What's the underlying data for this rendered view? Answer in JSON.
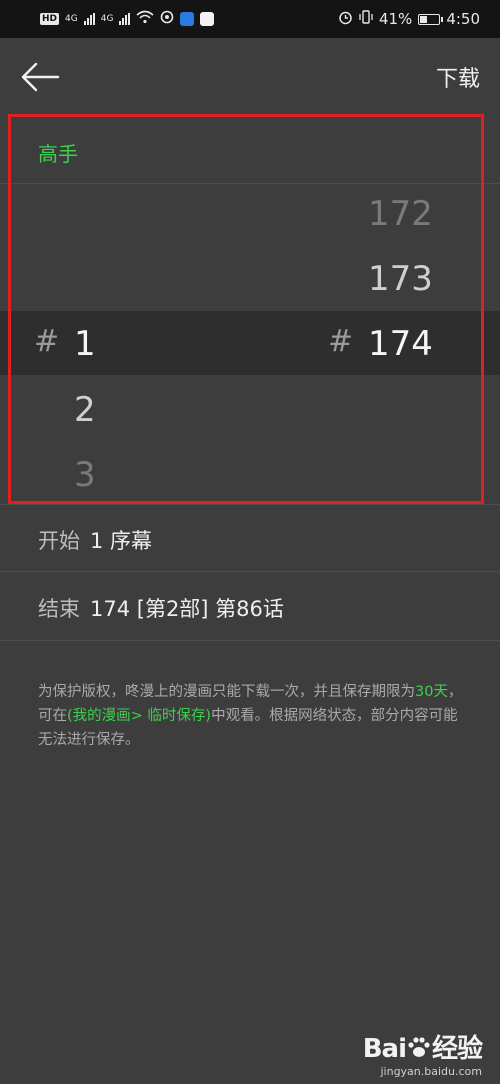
{
  "status_bar": {
    "network_hd": "HD",
    "net_type_1": "4G",
    "net_type_2": "4G",
    "battery_percent": "41%",
    "battery_level": 0.41,
    "time": "4:50"
  },
  "header": {
    "download_label": "下载"
  },
  "picker": {
    "title": "高手",
    "hash_symbol": "#",
    "start_column": [
      "1",
      "2",
      "3"
    ],
    "end_column": [
      "172",
      "173",
      "174"
    ],
    "selected_start": "1",
    "selected_end": "174"
  },
  "range": {
    "start_label": "开始",
    "start_value": "1 序幕",
    "end_label": "结束",
    "end_value": "174 [第2部] 第86话"
  },
  "notice": {
    "part1": "为保护版权，咚漫上的漫画只能下载一次，并且保存期限为",
    "days": "30天",
    "part2": "，可在",
    "location": "(我的漫画> 临时保存)",
    "part3": "中观看。根据网络状态，部分内容可能无法进行保存。"
  },
  "watermark": {
    "brand_left": "Bai",
    "brand_right": "经验",
    "url": "jingyan.baidu.com"
  },
  "colors": {
    "background": "#3d3d3d",
    "accent_green": "#3ecf4e",
    "highlight_red": "#e02020"
  }
}
